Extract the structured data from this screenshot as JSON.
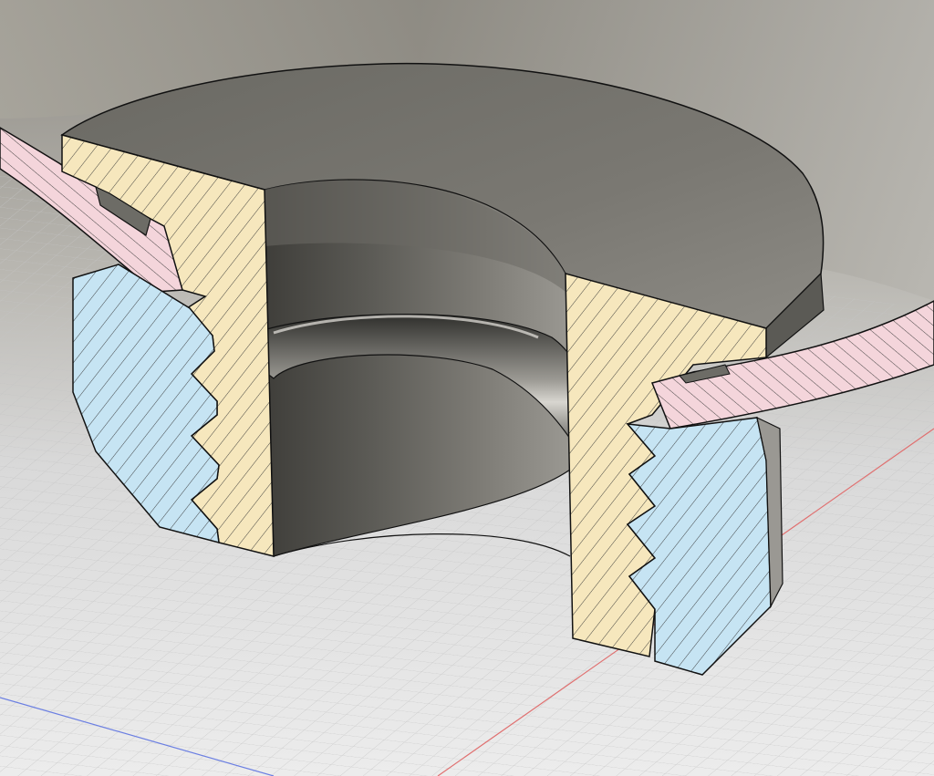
{
  "viewport": {
    "background_top": "#8f8d86",
    "background_bottom": "#e6e6e6",
    "grid_color": "#c9c9c9",
    "axis_red": "#e06a6a",
    "axis_blue": "#6a7fe0"
  },
  "model": {
    "hatch_colors": {
      "insert": "#f6e7bd",
      "nut": "#c6e4f3",
      "panel": "#f4d5db"
    },
    "hatch_line": "#2a2a2a",
    "body_shade_dark": "#4e4d48",
    "body_shade_mid": "#77756e",
    "body_shade_light": "#a09d94"
  }
}
